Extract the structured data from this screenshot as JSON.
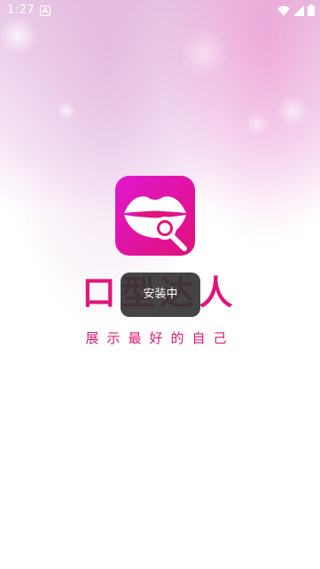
{
  "status_bar": {
    "time": "1:27",
    "notification_icon": "app-store-icon",
    "icons": [
      "wifi-icon",
      "cellular-signal-icon",
      "battery-icon"
    ]
  },
  "splash": {
    "app_icon": "lips-microphone-icon",
    "app_name": "口型达人",
    "slogan": "展示最好的自己"
  },
  "toast": {
    "message": "安装中"
  },
  "colors": {
    "brand_pink": "#e0157a",
    "icon_gradient_start": "#e018d0",
    "icon_gradient_end": "#e0107a"
  }
}
